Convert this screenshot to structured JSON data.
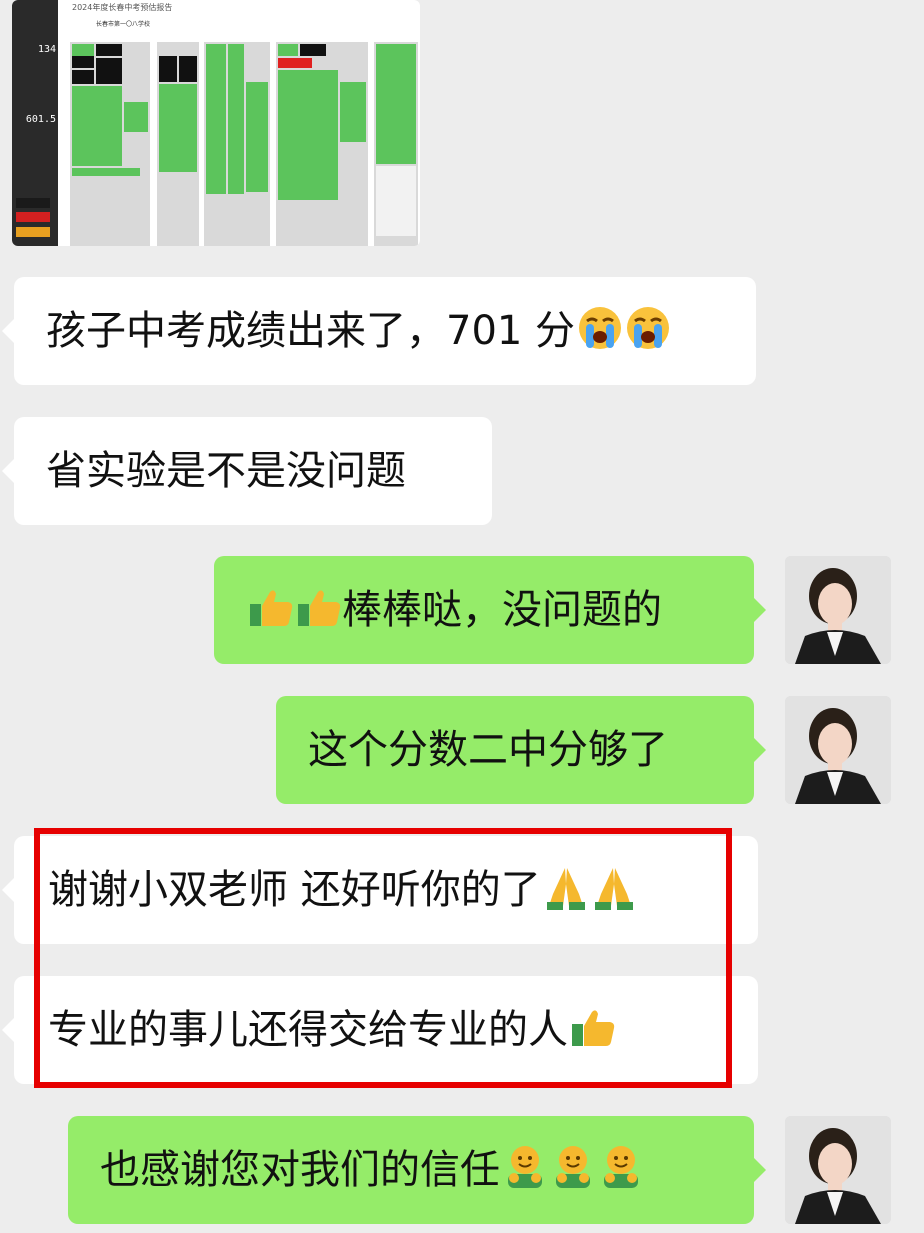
{
  "shared_image": {
    "title": "2024年度长春中考预估报告",
    "subtitle": "长春市第一〇八学校",
    "score_top": "134",
    "score_bottom": "601.5",
    "side_tags": [
      "",
      "",
      ""
    ],
    "columns": [
      "",
      "",
      "",
      "",
      ""
    ]
  },
  "messages": [
    {
      "side": "in",
      "text": "孩子中考成绩出来了，701 分",
      "emojis": [
        "loudly-crying-face-icon",
        "loudly-crying-face-icon"
      ]
    },
    {
      "side": "in",
      "text": "省实验是不是没问题",
      "emojis": []
    },
    {
      "side": "out",
      "prefix_emojis": [
        "thumbs-up-icon",
        "thumbs-up-icon"
      ],
      "text": "棒棒哒，没问题的",
      "emojis": []
    },
    {
      "side": "out",
      "text": "这个分数二中分够了",
      "emojis": []
    },
    {
      "side": "in",
      "text": "谢谢小双老师 还好听你的了",
      "emojis": [
        "folded-hands-icon",
        "folded-hands-icon"
      ]
    },
    {
      "side": "in",
      "text": "专业的事儿还得交给专业的人",
      "emojis": [
        "thumbs-up-icon"
      ]
    },
    {
      "side": "out",
      "text": "也感谢您对我们的信任",
      "emojis": [
        "hugging-face-icon",
        "hugging-face-icon",
        "hugging-face-icon"
      ]
    }
  ],
  "colors": {
    "chat_background": "#ededed",
    "incoming_bubble": "#ffffff",
    "outgoing_bubble": "#95ec69",
    "highlight_box": "#e60000",
    "table_green": "#5cc45c"
  }
}
